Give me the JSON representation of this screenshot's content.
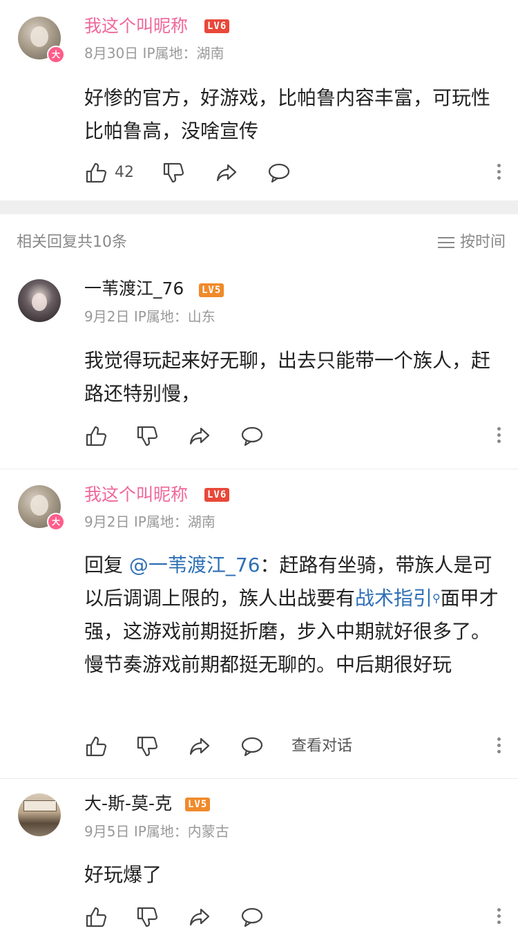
{
  "top_comment": {
    "username": "我这个叫昵称",
    "level": "LV6",
    "verified_badge": "大",
    "date": "8月30日",
    "ip_location": "IP属地：湖南",
    "text": "好惨的官方，好游戏，比帕鲁内容丰富，可玩性比帕鲁高，没啥宣传",
    "likes": "42"
  },
  "replies_header": {
    "title": "相关回复共10条",
    "sort_label": "按时间"
  },
  "replies": [
    {
      "username": "一苇渡江_76",
      "level": "LV5",
      "date": "9月2日",
      "ip_location": "IP属地：山东",
      "text": "我觉得玩起来好无聊，出去只能带一个族人，赶路还特别慢，"
    },
    {
      "username": "我这个叫昵称",
      "level": "LV6",
      "verified_badge": "大",
      "date": "9月2日",
      "ip_location": "IP属地：湖南",
      "reply_prefix": "回复 ",
      "mention": "@一苇渡江_76",
      "text_1": "：赶路有坐骑，带族人是可以后调调上限的，族人出战要有",
      "link_text": "战术指引",
      "text_2": "面甲才强，这游戏前期挺折磨，步入中期就好很多了。慢节奏游戏前期都挺无聊的。中后期很好玩",
      "view_thread": "查看对话"
    },
    {
      "username": "大-斯-莫-克",
      "level": "LV5",
      "date": "9月5日",
      "ip_location": "IP属地：内蒙古",
      "text": "好玩爆了"
    }
  ],
  "colors": {
    "vip_name": "#f0689a",
    "level6": "#e8483a",
    "level5": "#f08a2a",
    "link": "#2d6fb5"
  },
  "icons": [
    "thumbs-up-icon",
    "thumbs-down-icon",
    "share-icon",
    "comment-icon",
    "more-icon",
    "sort-icon",
    "search-icon"
  ]
}
